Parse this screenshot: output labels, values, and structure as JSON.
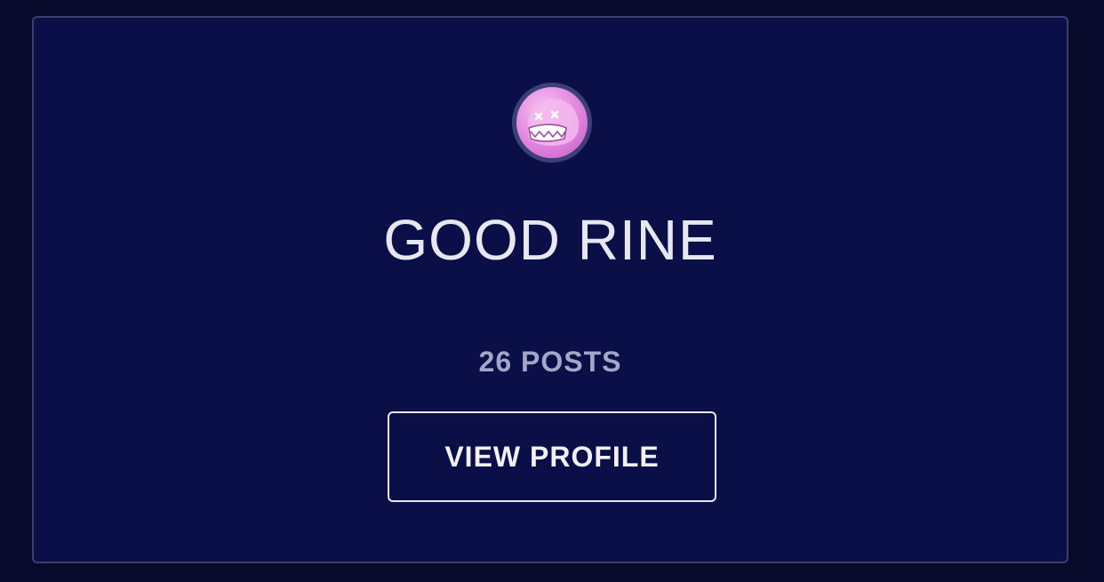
{
  "profile_card": {
    "avatar_icon": "pink-ghost-avatar-icon",
    "name": "GOOD RINE",
    "posts": "26 POSTS",
    "view_profile_label": "VIEW PROFILE"
  },
  "colors": {
    "page_background": "#070a2b",
    "card_background": "#0b0f48",
    "card_border": "#3b3f6e",
    "name_text": "#e7e7f0",
    "posts_text": "#a3a6c4",
    "avatar_pink": "#e58ee1"
  }
}
